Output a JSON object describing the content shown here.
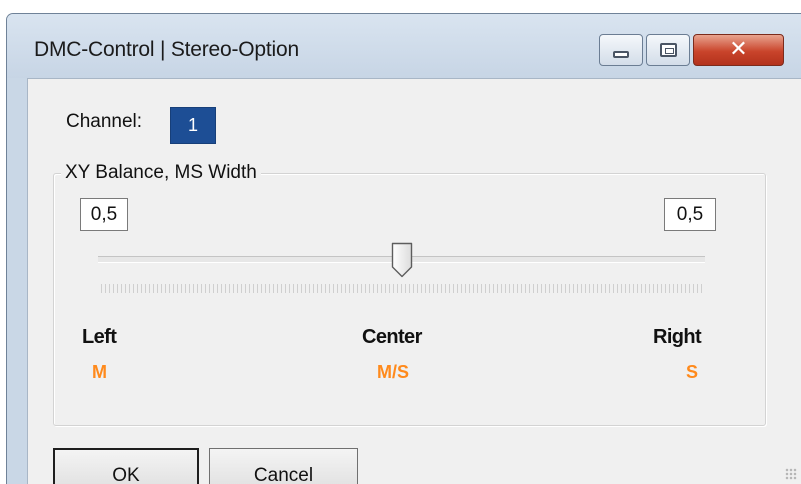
{
  "window": {
    "title": "DMC-Control | Stereo-Option",
    "close_glyph": "✕",
    "icons": [
      "minimize-icon",
      "maximize-icon",
      "close-icon"
    ]
  },
  "channel": {
    "label": "Channel:",
    "value": "1"
  },
  "group": {
    "title": "XY Balance, MS Width"
  },
  "slider": {
    "left_value": "0,5",
    "right_value": "0,5",
    "position_fraction": 0.5,
    "labels": {
      "left": "Left",
      "center": "Center",
      "right": "Right"
    },
    "modes": {
      "left": "M",
      "center": "M/S",
      "right": "S"
    },
    "mode_color": "#ff8a1c"
  },
  "buttons": {
    "ok": "OK",
    "cancel": "Cancel"
  }
}
